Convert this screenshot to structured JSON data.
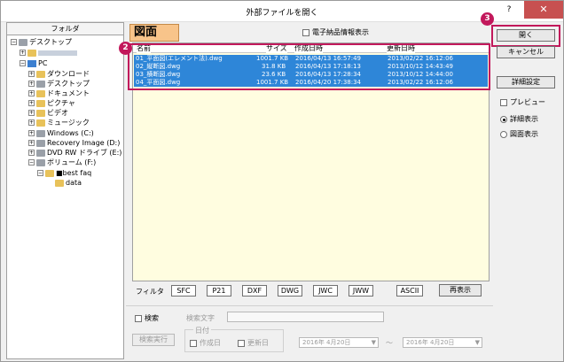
{
  "window": {
    "title": "外部ファイルを開く",
    "help": "?",
    "close": "✕"
  },
  "folder_panel": {
    "header": "フォルダ",
    "tree": [
      {
        "label": "デスクトップ"
      },
      {
        "label": ""
      },
      {
        "label": "PC"
      },
      {
        "label": "ダウンロード"
      },
      {
        "label": "デスクトップ"
      },
      {
        "label": "ドキュメント"
      },
      {
        "label": "ピクチャ"
      },
      {
        "label": "ビデオ"
      },
      {
        "label": "ミュージック"
      },
      {
        "label": "Windows (C:)"
      },
      {
        "label": "Recovery Image (D:)"
      },
      {
        "label": "DVD RW ドライブ (E:)"
      },
      {
        "label": "ボリューム (F:)"
      },
      {
        "label": "■best faq"
      },
      {
        "label": "data"
      }
    ]
  },
  "tab": {
    "label": "図面"
  },
  "denshi_option": {
    "label": "電子納品情報表示",
    "checked": false
  },
  "file_list": {
    "columns": [
      "名前",
      "サイズ",
      "作成日時",
      "更新日時"
    ],
    "rows": [
      {
        "name": "01_平面図(エレメント法).dwg",
        "size": "1001.7 KB",
        "created": "2016/04/13 16:57:49",
        "updated": "2013/02/22 16:12:06"
      },
      {
        "name": "02_縦断図.dwg",
        "size": "31.8 KB",
        "created": "2016/04/13 17:18:13",
        "updated": "2013/10/12 14:43:49"
      },
      {
        "name": "03_横断図.dwg",
        "size": "23.6 KB",
        "created": "2016/04/13 17:28:34",
        "updated": "2013/10/12 14:44:00"
      },
      {
        "name": "04_平面図.dwg",
        "size": "1001.7 KB",
        "created": "2016/04/20 17:38:34",
        "updated": "2013/02/22 16:12:06"
      }
    ]
  },
  "filter": {
    "label": "フィルタ",
    "buttons": [
      "SFC",
      "P21",
      "DXF",
      "DWG",
      "JWC",
      "JWW",
      "ASCII"
    ],
    "redisplay": "再表示"
  },
  "search": {
    "checkbox_label": "検索",
    "text_label": "検索文字",
    "run_button": "検索実行",
    "date_group": "日付",
    "created_label": "作成日",
    "updated_label": "更新日",
    "date_from": "2016年 4月20日",
    "date_to": "2016年 4月20日",
    "tilde": "～"
  },
  "right": {
    "open_button": "開く",
    "cancel_button": "キャンセル",
    "detail_settings_button": "詳細設定",
    "preview_label": "プレビュー",
    "detail_view_label": "詳細表示",
    "drawing_view_label": "図面表示"
  },
  "badges": {
    "two": "2",
    "three": "3"
  },
  "colors": {
    "selection": "#2e86d8",
    "list_bg": "#fffde0",
    "tab": "#f8c48a",
    "callout": "#c2185b"
  }
}
